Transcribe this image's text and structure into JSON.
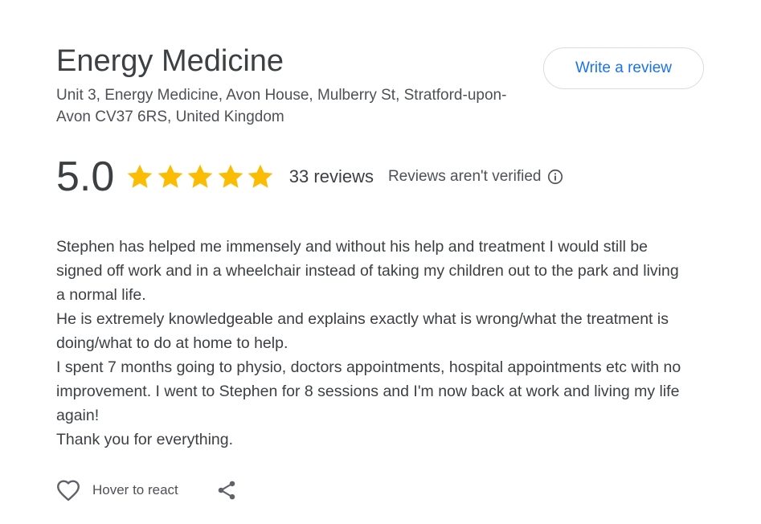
{
  "business": {
    "name": "Energy Medicine",
    "address": "Unit 3, Energy Medicine, Avon House, Mulberry St, Stratford-upon-Avon CV37 6RS, United Kingdom"
  },
  "write_review_label": "Write a review",
  "rating": {
    "value": "5.0",
    "stars": 5,
    "max_stars": 5,
    "review_count": "33 reviews",
    "verified_note": "Reviews aren't verified",
    "info_icon": "info-icon",
    "star_color": "#fbbc04"
  },
  "review": {
    "paragraphs": [
      "Stephen has helped me immensely and without his help and treatment I would still be signed off work and in a wheelchair instead of taking my children out to the park and living a normal life.",
      "He is extremely knowledgeable and explains exactly what is wrong/what the treatment is doing/what to do at home to help.",
      "I spent 7 months going to physio, doctors appointments, hospital appointments etc with no improvement. I went to Stephen for 8 sessions and I'm now back at work and living my life again!",
      "Thank you for everything."
    ]
  },
  "actions": {
    "react_label": "Hover to react",
    "react_icon": "heart-icon",
    "share_icon": "share-icon"
  },
  "colors": {
    "accent": "#1a73e8",
    "text": "#3c4043",
    "border": "#dadce0"
  }
}
